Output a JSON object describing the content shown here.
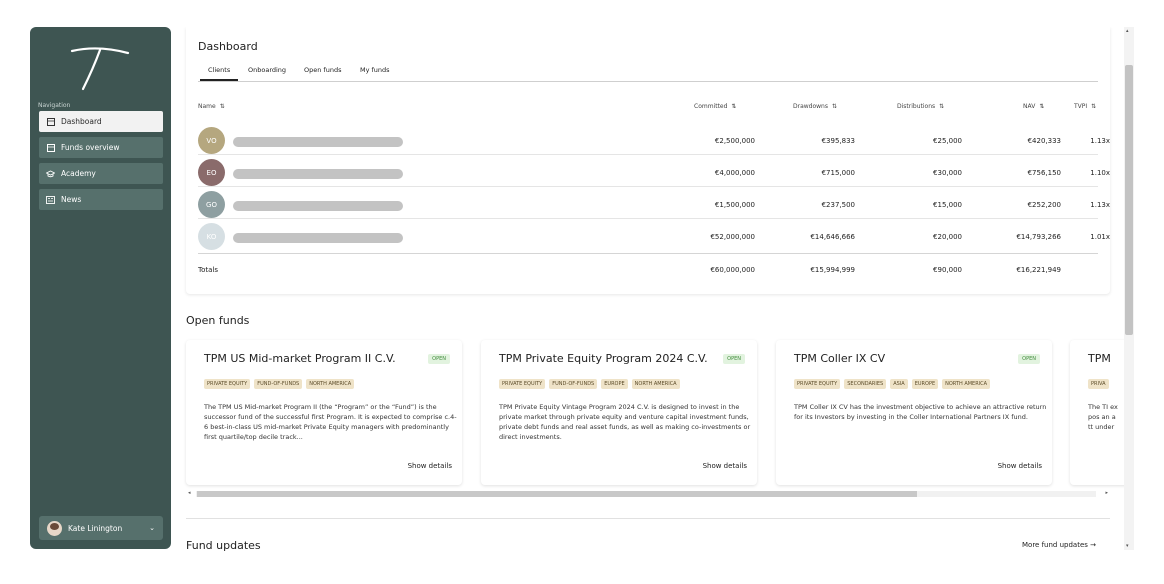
{
  "colors": {
    "sidebar_bg": "#3e5552",
    "nav_item_bg": "#56706c",
    "nav_active_bg": "#f2f2f2",
    "chip_bg": "#efe3c8",
    "open_tag_bg": "#e2f3df",
    "open_tag_text": "#3f8b3a"
  },
  "sidebar": {
    "logo_icon": "t-logo-icon",
    "nav_heading": "Navigation",
    "items": [
      {
        "label": "Dashboard",
        "icon": "grid-icon",
        "active": true
      },
      {
        "label": "Funds overview",
        "icon": "grid-icon",
        "active": false
      },
      {
        "label": "Academy",
        "icon": "graduation-cap-icon",
        "active": false
      },
      {
        "label": "News",
        "icon": "newspaper-icon",
        "active": false
      }
    ],
    "user": {
      "name": "Kate Linington",
      "icon": "chevron-down-icon"
    }
  },
  "dashboard": {
    "title": "Dashboard",
    "tabs": [
      "Clients",
      "Onboarding",
      "Open funds",
      "My funds"
    ],
    "active_tab": "Clients",
    "columns": [
      "Name",
      "Committed",
      "Drawdowns",
      "Distributions",
      "NAV",
      "TVPI"
    ],
    "rows": [
      {
        "initials": "VO",
        "color": "#b5a77f",
        "committed": "€2,500,000",
        "drawdowns": "€395,833",
        "distributions": "€25,000",
        "nav": "€420,333",
        "tvpi": "1.13x"
      },
      {
        "initials": "EO",
        "color": "#8a6b6b",
        "committed": "€4,000,000",
        "drawdowns": "€715,000",
        "distributions": "€30,000",
        "nav": "€756,150",
        "tvpi": "1.10x"
      },
      {
        "initials": "GO",
        "color": "#8e9fa1",
        "committed": "€1,500,000",
        "drawdowns": "€237,500",
        "distributions": "€15,000",
        "nav": "€252,200",
        "tvpi": "1.13x"
      },
      {
        "initials": "KO",
        "color": "#d6dfe3",
        "committed": "€52,000,000",
        "drawdowns": "€14,646,666",
        "distributions": "€20,000",
        "nav": "€14,793,266",
        "tvpi": "1.01x"
      }
    ],
    "totals": {
      "label": "Totals",
      "committed": "€60,000,000",
      "drawdowns": "€15,994,999",
      "distributions": "€90,000",
      "nav": "€16,221,949"
    }
  },
  "open_funds": {
    "title": "Open funds",
    "show_details_label": "Show details",
    "cards": [
      {
        "name": "TPM US Mid-market Program II C.V.",
        "status": "OPEN",
        "tags": [
          "PRIVATE EQUITY",
          "FUND-OF-FUNDS",
          "NORTH AMERICA"
        ],
        "description": "The TPM US Mid-market Program II (the “Program” or the “Fund”) is the successor fund of the successful first Program. It is expected to comprise c.4-6 best-in-class US mid-market Private Equity managers with predominantly first quartile/top decile track..."
      },
      {
        "name": "TPM Private Equity Program 2024 C.V.",
        "status": "OPEN",
        "tags": [
          "PRIVATE EQUITY",
          "FUND-OF-FUNDS",
          "EUROPE",
          "NORTH AMERICA"
        ],
        "description": "TPM Private Equity Vintage Program 2024 C.V. is designed to invest in the private market through private equity and venture capital investment funds, private debt funds and real asset funds, as well as making co-investments or direct investments."
      },
      {
        "name": "TPM Coller IX CV",
        "status": "OPEN",
        "tags": [
          "PRIVATE EQUITY",
          "SECONDARIES",
          "ASIA",
          "EUROPE",
          "NORTH AMERICA"
        ],
        "description": "TPM Coller IX CV has the investment objective to achieve an attractive return for its Investors by investing in the Coller International Partners IX fund."
      },
      {
        "name": "TPM",
        "status": "",
        "tags": [
          "PRIVA"
        ],
        "description": "The TI expos an att under"
      }
    ]
  },
  "fund_updates": {
    "title": "Fund updates",
    "more_label": "More fund updates →"
  }
}
